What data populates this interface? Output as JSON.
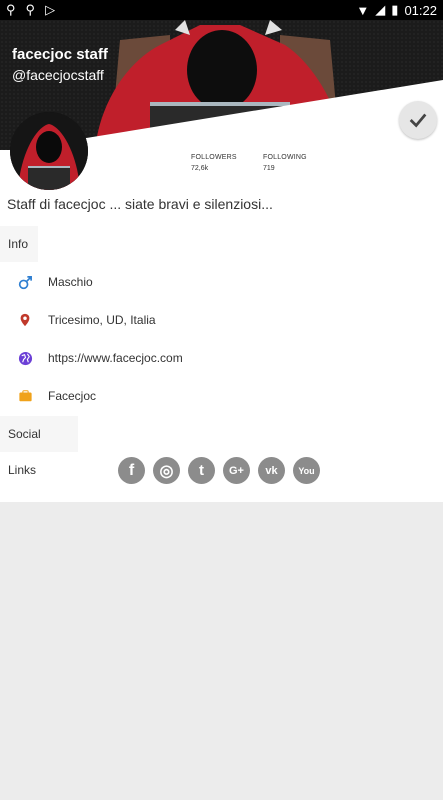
{
  "status_bar": {
    "time": "01:22",
    "icons": [
      "usb-icon",
      "usb-icon",
      "play-store-icon",
      "wifi-icon",
      "signal-icon",
      "battery-icon"
    ]
  },
  "profile": {
    "name": "facecjoc staff",
    "handle": "@facecjocstaff",
    "bio": "Staff di facecjoc ... siate bravi e silenziosi..."
  },
  "stats": {
    "followers_label": "FOLLOWERS",
    "followers_value": "72,6k",
    "following_label": "FOLLOWING",
    "following_value": "719"
  },
  "info": {
    "section_label": "Info",
    "items": [
      {
        "icon": "male-icon",
        "text": "Maschio",
        "color": "#2f7fd1"
      },
      {
        "icon": "location-pin-icon",
        "text": "Tricesimo, UD, Italia",
        "color": "#c0392b"
      },
      {
        "icon": "globe-icon",
        "text": "https://www.facecjoc.com",
        "color": "#6b3fd6"
      },
      {
        "icon": "briefcase-icon",
        "text": "Facecjoc",
        "color": "#f0a21a"
      }
    ]
  },
  "social": {
    "section_label": "Social Links",
    "items": [
      {
        "icon": "facebook-icon",
        "glyph": "f"
      },
      {
        "icon": "instagram-icon",
        "glyph": "◎"
      },
      {
        "icon": "twitter-icon",
        "glyph": "t"
      },
      {
        "icon": "google-plus-icon",
        "glyph": "G+"
      },
      {
        "icon": "vk-icon",
        "glyph": "vk"
      },
      {
        "icon": "youtube-icon",
        "glyph": "You"
      }
    ]
  },
  "colors": {
    "header_bg": "#1b1b1b",
    "hood_red": "#d0232f",
    "social_grey": "#8c8c8c"
  }
}
